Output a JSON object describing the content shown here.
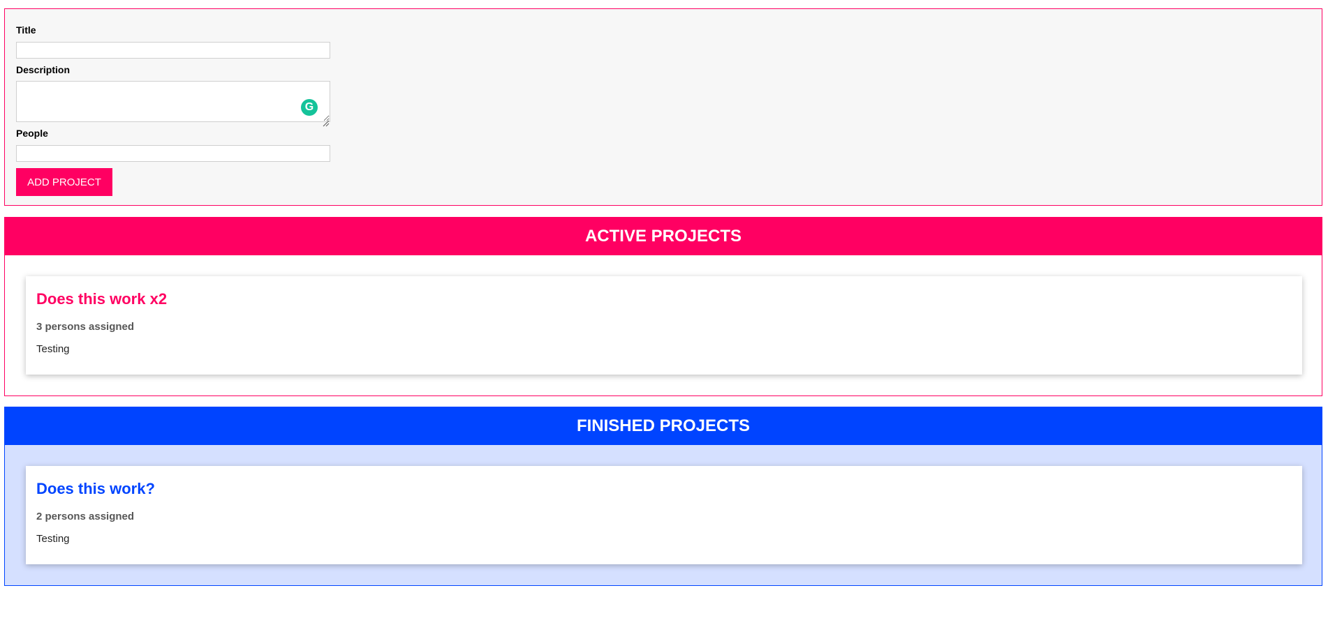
{
  "form": {
    "title_label": "Title",
    "title_value": "",
    "description_label": "Description",
    "description_value": "",
    "people_label": "People",
    "people_value": "",
    "submit_label": "ADD PROJECT",
    "grammarly_glyph": "G"
  },
  "active": {
    "header": "ACTIVE PROJECTS",
    "accent_color": "#ff0062",
    "projects": [
      {
        "title": "Does this work x2",
        "people": "3 persons assigned",
        "description": "Testing"
      }
    ]
  },
  "finished": {
    "header": "FINISHED PROJECTS",
    "accent_color": "#0044ff",
    "projects": [
      {
        "title": "Does this work?",
        "people": "2 persons assigned",
        "description": "Testing"
      }
    ]
  }
}
